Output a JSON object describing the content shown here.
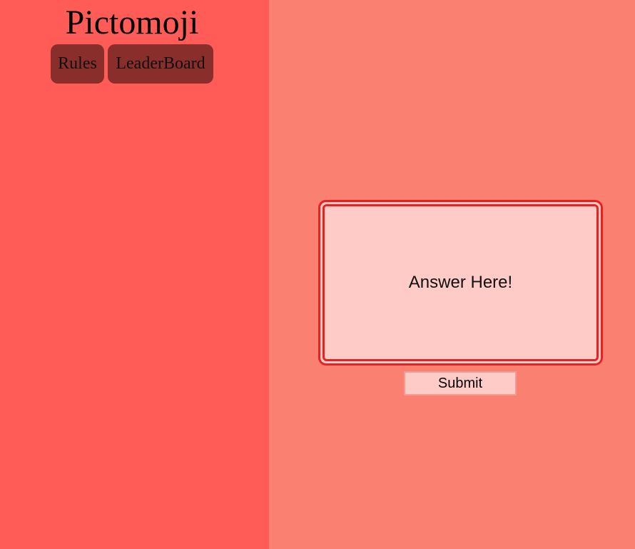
{
  "app": {
    "title": "Pictomoji"
  },
  "nav": {
    "rules_label": "Rules",
    "leaderboard_label": "LeaderBoard"
  },
  "answer": {
    "placeholder": "Answer Here!"
  },
  "submit": {
    "label": "Submit"
  },
  "colors": {
    "left_panel": "#ff5b57",
    "right_panel": "#fa8072",
    "nav_button": "#892e2b",
    "answer_border": "#e62222",
    "answer_fill": "#ffcbc7"
  }
}
